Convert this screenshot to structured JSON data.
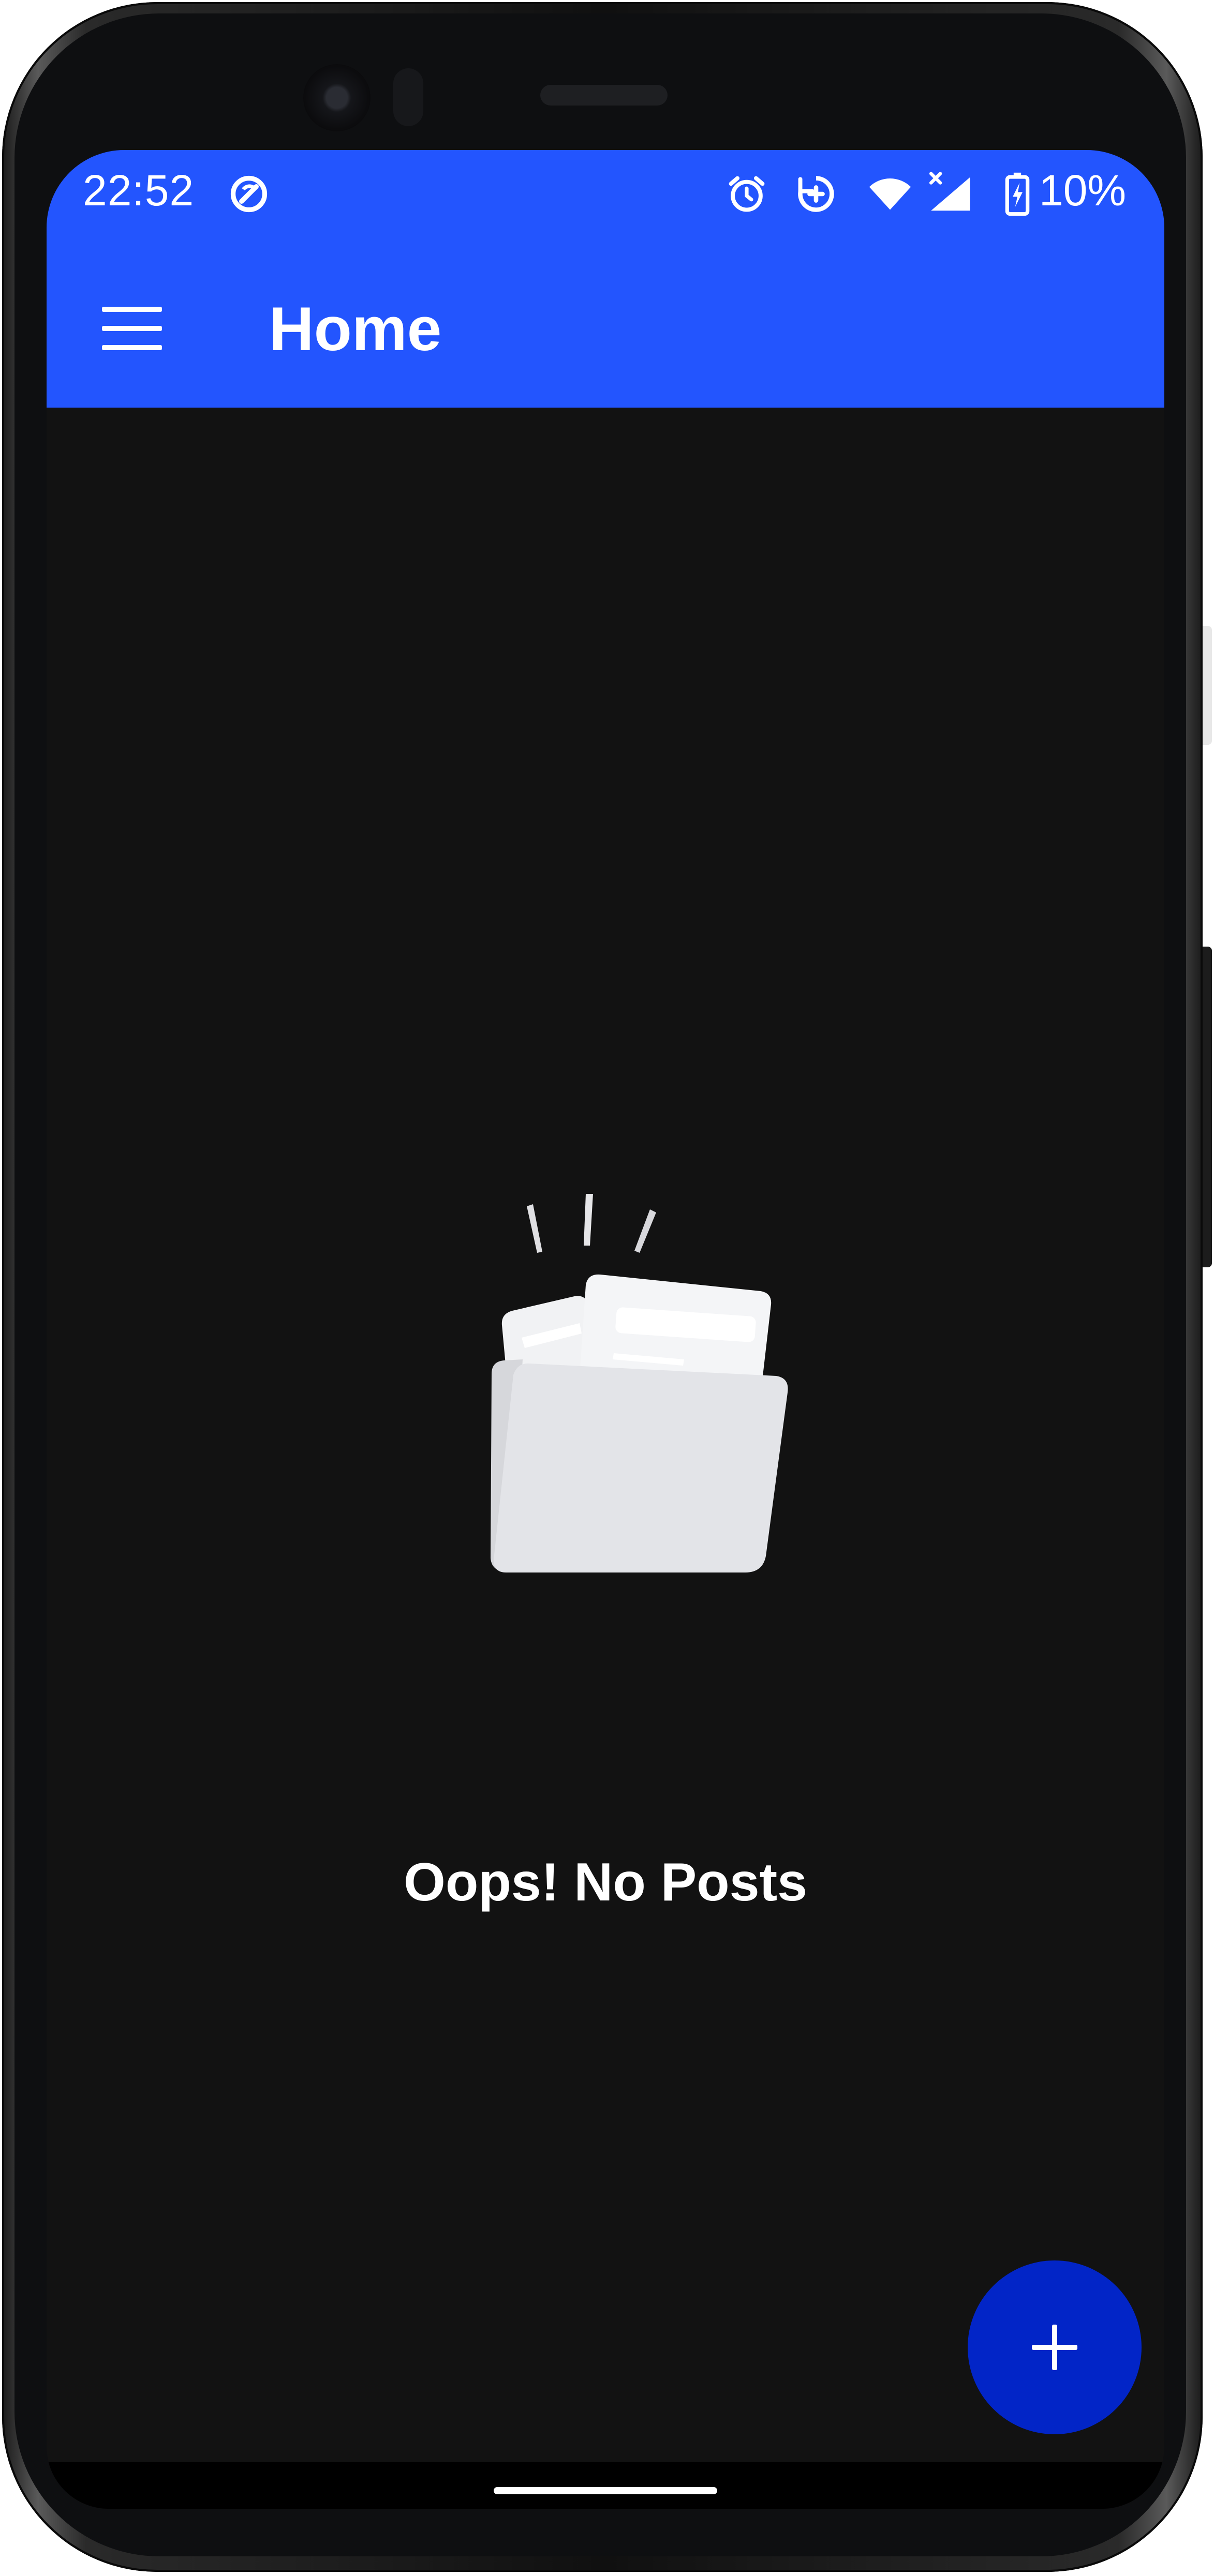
{
  "status_bar": {
    "time": "22:52",
    "battery_percent": "10%",
    "icons": [
      "data-saver-icon",
      "alarm-icon",
      "sync-icon",
      "wifi-icon",
      "signal-icon",
      "battery-charging-icon"
    ]
  },
  "app_bar": {
    "title": "Home",
    "menu_icon": "hamburger-menu-icon",
    "color": "#2355fe"
  },
  "empty_state": {
    "icon": "empty-folder-icon",
    "message": "Oops! No Posts"
  },
  "fab": {
    "icon": "plus-icon",
    "color": "#0225c7"
  },
  "theme": {
    "background": "#121212"
  }
}
